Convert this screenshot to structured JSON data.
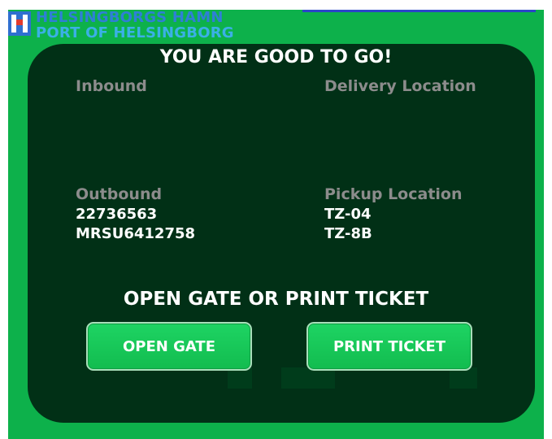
{
  "logo": {
    "line1": "HELSINGBORGS HAMN",
    "line2": "PORT OF HELSINGBORG"
  },
  "panel": {
    "title": "YOU ARE GOOD TO GO!",
    "inbound_label": "Inbound",
    "delivery_label": "Delivery Location",
    "outbound_label": "Outbound",
    "pickup_label": "Pickup Location",
    "outbound_values": [
      "22736563",
      "MRSU6412758"
    ],
    "pickup_values": [
      "TZ-04",
      "TZ-8B"
    ],
    "prompt": "OPEN GATE OR PRINT TICKET"
  },
  "buttons": {
    "open_gate": "OPEN GATE",
    "print_ticket": "PRINT TICKET"
  },
  "colors": {
    "background": "#0db14b",
    "panel": "#013016",
    "button": "#1ed463",
    "label": "#8c8c8c"
  }
}
